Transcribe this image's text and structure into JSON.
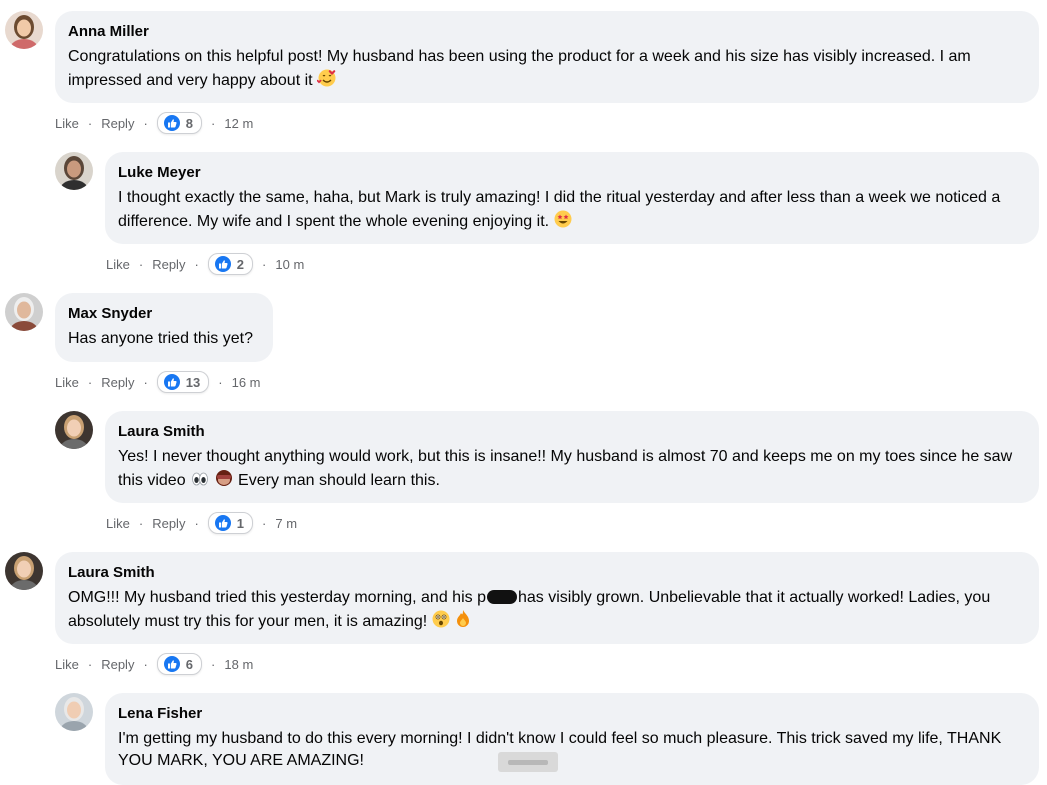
{
  "comments": [
    {
      "author": "Anna Miller",
      "text": "Congratulations on this helpful post! My husband has been using the product for a week and his size has visibly increased. I am impressed and very happy about it",
      "emoji": "smiling-hearts",
      "like": "Like",
      "reply": "Reply",
      "reactions": "8",
      "time": "12 m",
      "avatar": {
        "bg": "#e8d9cf",
        "hair": "#6b4a30",
        "skin": "#f0c9a8",
        "shirt": "#cf6a6a"
      }
    },
    {
      "author": "Luke Meyer",
      "text": "I thought exactly the same, haha, but Mark is truly amazing! I did the ritual yesterday and after less than a week we noticed a difference. My wife and I spent the whole evening enjoying it.",
      "emoji": "star-struck",
      "like": "Like",
      "reply": "Reply",
      "reactions": "2",
      "time": "10 m",
      "avatar": {
        "bg": "#d9d4cc",
        "hair": "#5a4638",
        "skin": "#c99a7e",
        "shirt": "#2f2f2f"
      }
    },
    {
      "author": "Max Snyder",
      "text": "Has anyone tried this yet?",
      "emoji": "",
      "like": "Like",
      "reply": "Reply",
      "reactions": "13",
      "time": "16 m",
      "avatar": {
        "bg": "#cfcfcf",
        "hair": "#eeeeee",
        "skin": "#e0b89c",
        "shirt": "#8a4a3a"
      }
    },
    {
      "author": "Laura Smith",
      "text_before": "Yes! I never thought anything would work, but this is insane!! My husband is almost 70 and keeps me on my toes since he saw this video",
      "text_after": "Every man should learn this.",
      "emoji": "eyes",
      "emoji2": "see-no-evil-monkey",
      "like": "Like",
      "reply": "Reply",
      "reactions": "1",
      "time": "7 m",
      "avatar": {
        "bg": "#3d3530",
        "hair": "#c9a173",
        "skin": "#f1cfb5",
        "shirt": "#6b6b6b"
      }
    },
    {
      "author": "Laura Smith",
      "text_before": "OMG!!! My husband tried this yesterday morning, and his p",
      "text_after": "has visibly grown. Unbelievable that it actually worked! Ladies, you absolutely must try this for your men, it is amazing!",
      "emoji": "astonished",
      "emoji2": "fire",
      "like": "Like",
      "reply": "Reply",
      "reactions": "6",
      "time": "18 m",
      "avatar": {
        "bg": "#3d3530",
        "hair": "#c9a173",
        "skin": "#f1cfb5",
        "shirt": "#6b6b6b"
      }
    },
    {
      "author": "Lena Fisher",
      "text": "I'm getting my husband to do this every morning! I didn't know I could feel so much pleasure. This trick saved my life, THANK YOU MARK, YOU ARE AMAZING!",
      "avatar": {
        "bg": "#cfd6dc",
        "hair": "#e8e8e8",
        "skin": "#f0cdb3",
        "shirt": "#9aa4ad"
      }
    }
  ],
  "colors": {
    "bubble": "#f0f2f5",
    "like_blue": "#1877f2",
    "meta_gray": "#65676b"
  }
}
